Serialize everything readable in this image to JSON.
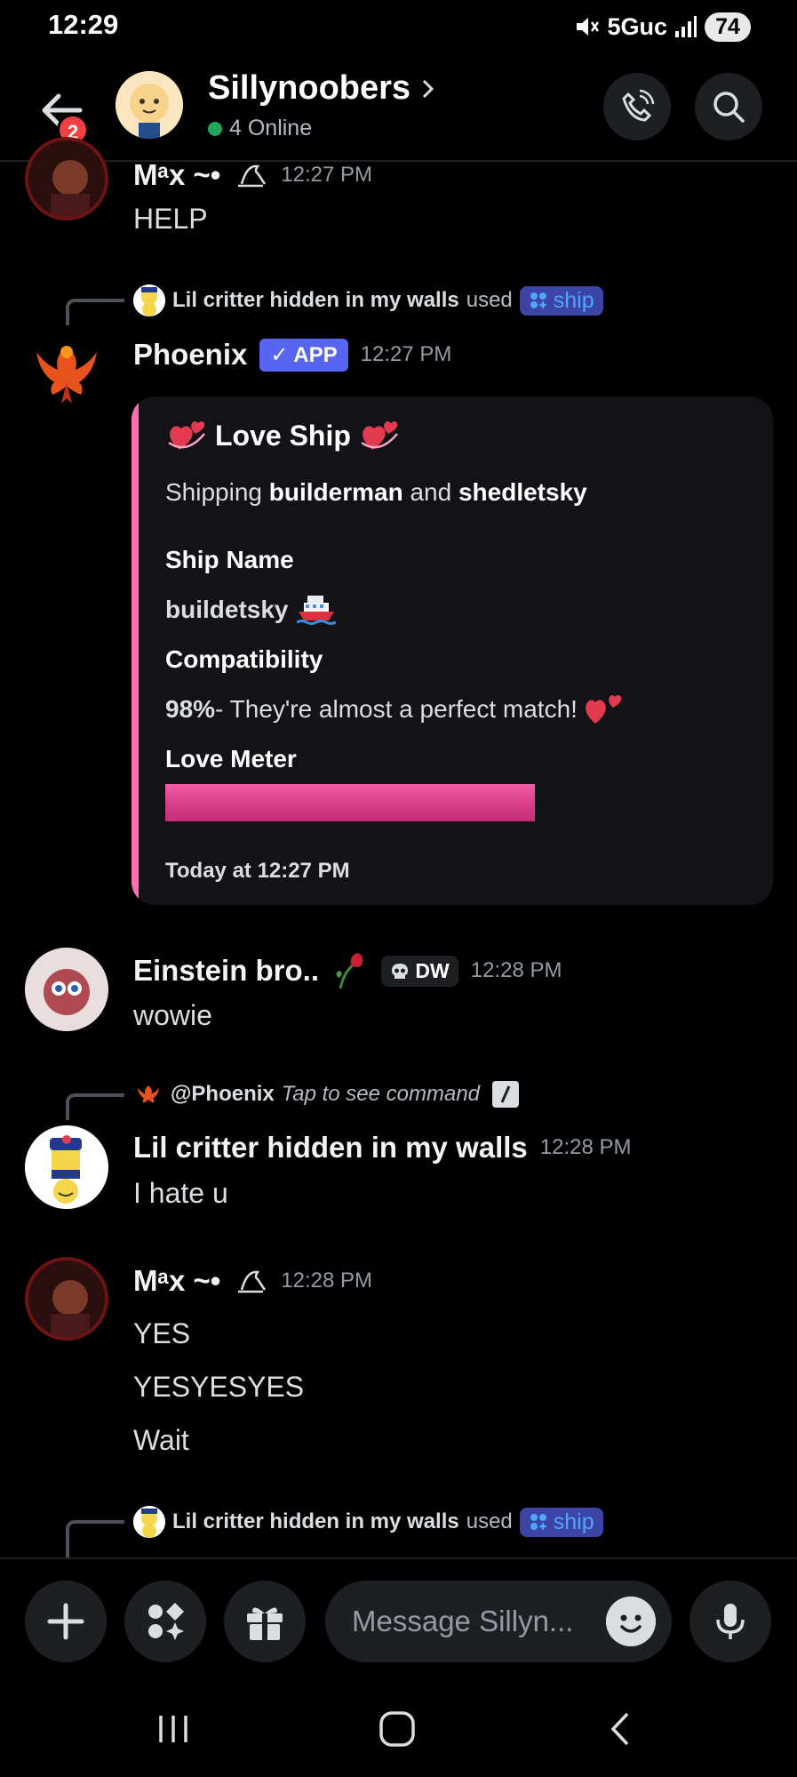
{
  "status": {
    "time": "12:29",
    "network": "5Guc",
    "battery": "74"
  },
  "header": {
    "title": "Sillynoobers",
    "online": "4 Online",
    "unread_badge": "2"
  },
  "messages": {
    "m1": {
      "author": "Mᵃx ~•",
      "time": "12:27 PM",
      "text": "HELP"
    },
    "reply1": {
      "user": "Lil critter hidden in my walls",
      "used": "used",
      "command": "ship"
    },
    "m2": {
      "author": "Phoenix",
      "badge": "✓ APP",
      "time": "12:27 PM"
    },
    "embed": {
      "title": "Love Ship",
      "desc_prefix": "Shipping",
      "name_a": "builderman",
      "desc_and": "and",
      "name_b": "shedletsky",
      "field1_name": "Ship Name",
      "field1_value": "buildetsky",
      "field2_name": "Compatibility",
      "field2_percent": "98%",
      "field2_text": " - They're almost a perfect match!",
      "field3_name": "Love Meter",
      "love_meter_percent": 98,
      "footer": "Today at 12:27 PM",
      "accent": "#ff6fb0"
    },
    "m3": {
      "author": "Einstein bro..",
      "badge": "DW",
      "time": "12:28 PM",
      "text": "wowie"
    },
    "reply2": {
      "mention": "@Phoenix",
      "hint": "Tap to see command"
    },
    "m4": {
      "author": "Lil critter hidden in my walls",
      "time": "12:28 PM",
      "text": "I hate u"
    },
    "m5": {
      "author": "Mᵃx ~•",
      "time": "12:28 PM",
      "lines": [
        "YES",
        "YESYESYES",
        "Wait"
      ]
    },
    "reply3": {
      "user": "Lil critter hidden in my walls",
      "used": "used",
      "command": "ship"
    }
  },
  "composer": {
    "placeholder": "Message Sillyn..."
  },
  "icons": {
    "back": "arrow-left-icon",
    "call": "phone-call-icon",
    "search": "search-icon",
    "add": "plus-icon",
    "apps": "apps-icon",
    "gift": "gift-icon",
    "emoji": "emoji-icon",
    "mic": "microphone-icon"
  }
}
